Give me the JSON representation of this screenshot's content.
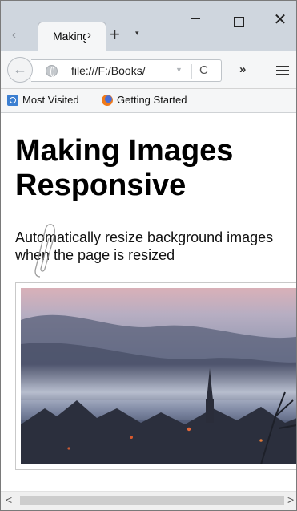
{
  "browser": {
    "tab": {
      "title": "Making Images Responsive",
      "scroll_left": "‹",
      "scroll_right": "›",
      "new_tab": "+",
      "list": "▾"
    },
    "window_controls": {
      "close": "✕"
    },
    "nav": {
      "url": "file:///F:/Books/",
      "url_dropdown": "▼",
      "reload": "C",
      "overflow": "»"
    },
    "bookmarks": [
      {
        "label": "Most Visited",
        "icon": "most-visited-icon"
      },
      {
        "label": "Getting Started",
        "icon": "firefox-icon"
      }
    ]
  },
  "page": {
    "heading": "Making Images Responsive",
    "text": "Automatically resize background images when the page is resized",
    "image": "misty-village-photo"
  },
  "scrollbar": {
    "left": "<",
    "right": ">"
  },
  "colors": {
    "tabstrip": "#cfd6de",
    "toolbar": "#f5f6f7",
    "accent": "#3c7fd1"
  }
}
